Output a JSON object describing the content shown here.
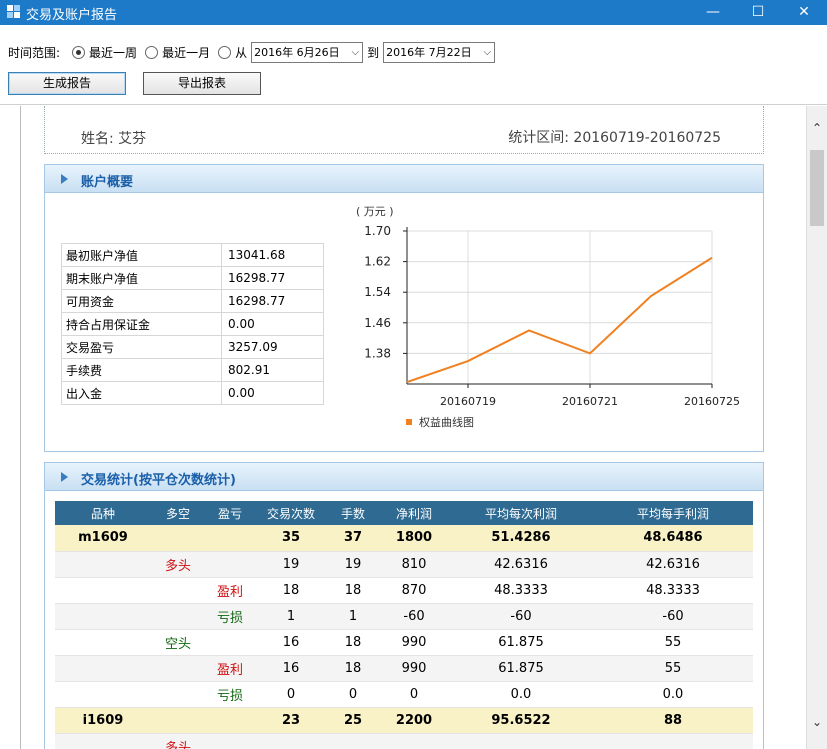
{
  "window": {
    "title": "交易及账户报告",
    "min_glyph": "—",
    "max_glyph": "☐",
    "close_glyph": "✕"
  },
  "toolbar": {
    "range_label": "时间范围:",
    "radios": [
      "最近一周",
      "最近一月",
      "从"
    ],
    "selected_radio": 0,
    "date_from": "2016年 6月26日",
    "date_to": "2016年 7月22日",
    "to_label": "到",
    "generate_label": "生成报告",
    "export_label": "导出报表"
  },
  "info": {
    "name": "姓名: 艾芬",
    "period": "统计区间: 20160719-20160725"
  },
  "summary": {
    "title": "账户概要",
    "rows": [
      {
        "k": "最初账户净值",
        "v": "13041.68"
      },
      {
        "k": "期末账户净值",
        "v": "16298.77"
      },
      {
        "k": "可用资金",
        "v": "16298.77"
      },
      {
        "k": "持合占用保证金",
        "v": "0.00"
      },
      {
        "k": "交易盈亏",
        "v": "3257.09"
      },
      {
        "k": "手续费",
        "v": "802.91"
      },
      {
        "k": "出入金",
        "v": "0.00"
      }
    ]
  },
  "chart_data": {
    "type": "line",
    "unit": "( 万元 )",
    "ylim": [
      1.3,
      1.7
    ],
    "yticks": [
      "1.38",
      "1.46",
      "1.54",
      "1.62",
      "1.70"
    ],
    "ytick_values": [
      1.38,
      1.46,
      1.54,
      1.62,
      1.7
    ],
    "xticks": [
      "20160719",
      "20160721",
      "20160725"
    ],
    "xtick_positions": [
      1,
      3,
      5
    ],
    "xlim": [
      0,
      5
    ],
    "series": [
      {
        "name": "权益曲线图",
        "color": "#f08020",
        "x": [
          0,
          1,
          2,
          3,
          4,
          5
        ],
        "y": [
          1.305,
          1.36,
          1.44,
          1.38,
          1.53,
          1.63
        ]
      }
    ],
    "grid": true,
    "legend": "bottom-left"
  },
  "trades": {
    "title": "交易统计(按平仓次数统计)",
    "headers": [
      "品种",
      "多空",
      "盈亏",
      "交易次数",
      "手数",
      "净利润",
      "平均每次利润",
      "平均每手利润"
    ],
    "rows": [
      {
        "type": "sym",
        "c": [
          "m1609",
          "",
          "",
          "35",
          "37",
          "1800",
          "51.4286",
          "48.6486"
        ]
      },
      {
        "type": "dir",
        "c": [
          "",
          "多头",
          "",
          "19",
          "19",
          "810",
          "42.6316",
          "42.6316"
        ]
      },
      {
        "type": "pl",
        "c": [
          "",
          "",
          "盈利",
          "18",
          "18",
          "870",
          "48.3333",
          "48.3333"
        ]
      },
      {
        "type": "pl",
        "c": [
          "",
          "",
          "亏损",
          "1",
          "1",
          "-60",
          "-60",
          "-60"
        ]
      },
      {
        "type": "dir",
        "c": [
          "",
          "空头",
          "",
          "16",
          "18",
          "990",
          "61.875",
          "55"
        ]
      },
      {
        "type": "pl",
        "c": [
          "",
          "",
          "盈利",
          "16",
          "18",
          "990",
          "61.875",
          "55"
        ]
      },
      {
        "type": "pl",
        "c": [
          "",
          "",
          "亏损",
          "0",
          "0",
          "0",
          "0.0",
          "0.0"
        ]
      },
      {
        "type": "sym",
        "c": [
          "i1609",
          "",
          "",
          "23",
          "25",
          "2200",
          "95.6522",
          "88"
        ]
      },
      {
        "type": "dir",
        "c": [
          "",
          "多头",
          "",
          "",
          "",
          "",
          "",
          ""
        ]
      }
    ]
  },
  "colors": {
    "titlebar": "#1c7ac9",
    "table_header": "#2e6a92",
    "symbol_row": "#f9f2c6",
    "long": "#d01010",
    "short": "#116611"
  }
}
